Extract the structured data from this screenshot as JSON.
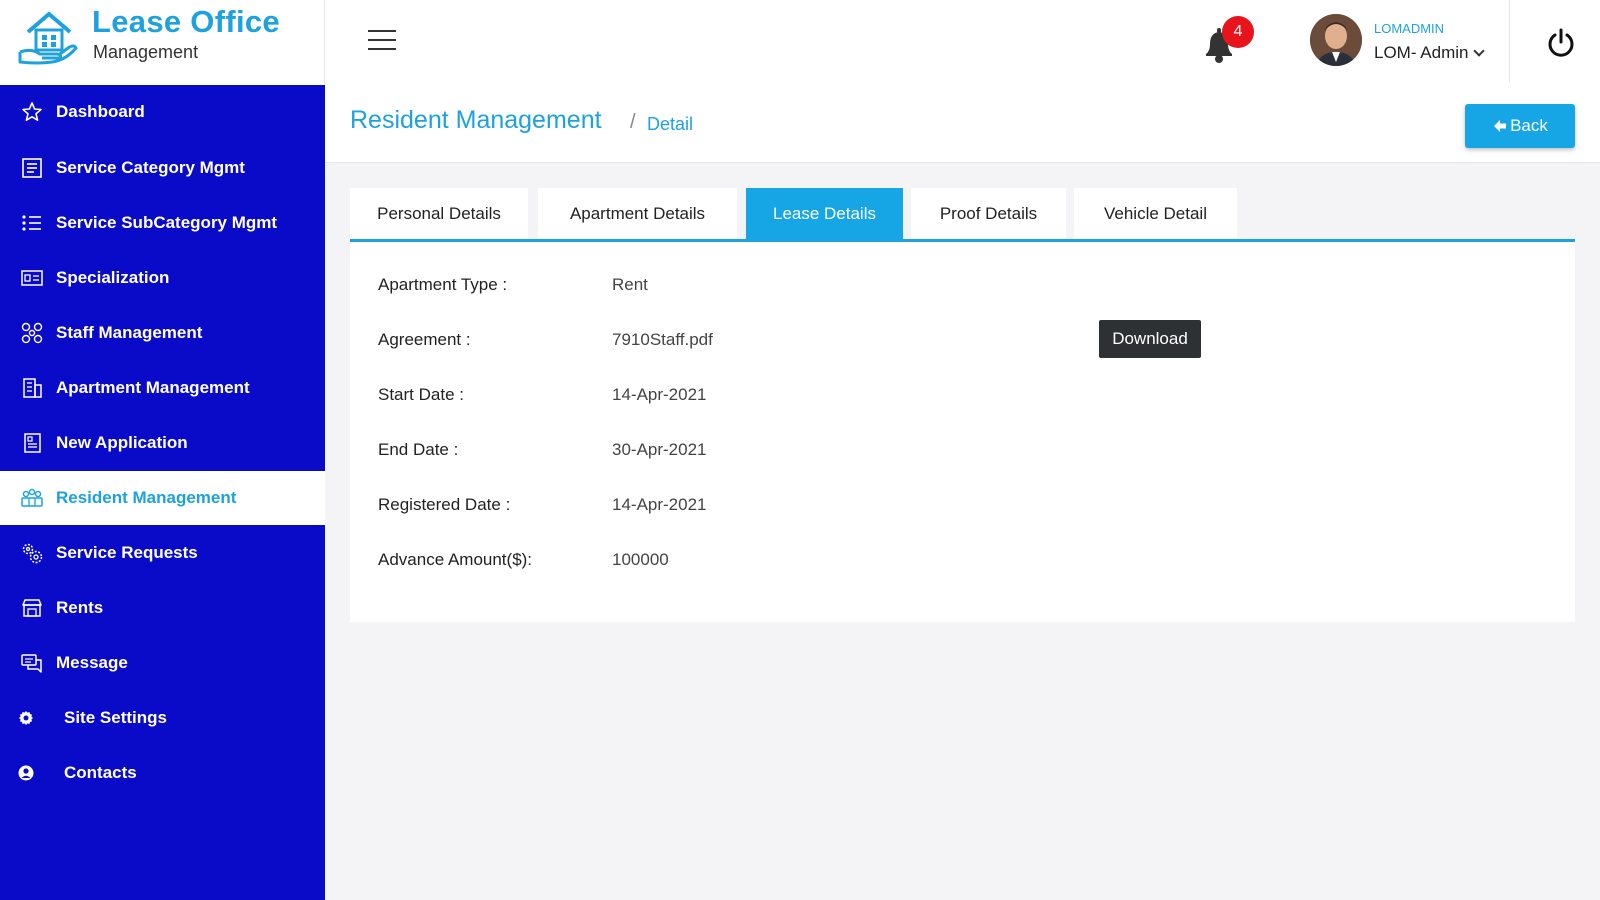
{
  "brand": {
    "title": "Lease Office",
    "subtitle": "Management",
    "color": "#1ea2de"
  },
  "header": {
    "notifications_count": "4",
    "user_role": "LOMADMIN",
    "user_name": "LOM- Admin"
  },
  "sidebar": {
    "bg_color": "#0a0bc8",
    "items": [
      {
        "label": "Dashboard",
        "icon": "star-icon"
      },
      {
        "label": "Service Category Mgmt",
        "icon": "list-box-icon"
      },
      {
        "label": "Service SubCategory Mgmt",
        "icon": "bullet-list-icon"
      },
      {
        "label": "Specialization",
        "icon": "id-card-icon"
      },
      {
        "label": "Staff Management",
        "icon": "network-icon"
      },
      {
        "label": "Apartment Management",
        "icon": "building-icon"
      },
      {
        "label": "New Application",
        "icon": "document-icon"
      },
      {
        "label": "Resident Management",
        "icon": "people-icon",
        "active": true
      },
      {
        "label": "Service Requests",
        "icon": "gear-cluster-icon"
      },
      {
        "label": "Rents",
        "icon": "store-icon"
      },
      {
        "label": "Message",
        "icon": "chat-icon"
      },
      {
        "label": "Site Settings",
        "icon": "gear-icon"
      },
      {
        "label": "Contacts",
        "icon": "user-circle-icon"
      }
    ]
  },
  "page": {
    "title": "Resident Management",
    "separator": "/",
    "breadcrumb": "Detail",
    "back_label": "Back"
  },
  "tabs": [
    {
      "label": "Personal Details"
    },
    {
      "label": "Apartment Details"
    },
    {
      "label": "Lease Details",
      "active": true
    },
    {
      "label": "Proof Details"
    },
    {
      "label": "Vehicle Detail"
    }
  ],
  "details": [
    {
      "label": "Apartment Type :",
      "value": "Rent"
    },
    {
      "label": "Agreement :",
      "value": "7910Staff.pdf"
    },
    {
      "label": "Start Date :",
      "value": "14-Apr-2021"
    },
    {
      "label": "End Date :",
      "value": "30-Apr-2021"
    },
    {
      "label": "Registered Date :",
      "value": "14-Apr-2021"
    },
    {
      "label": "Advance Amount($):",
      "value": "100000"
    }
  ],
  "download_label": "Download"
}
